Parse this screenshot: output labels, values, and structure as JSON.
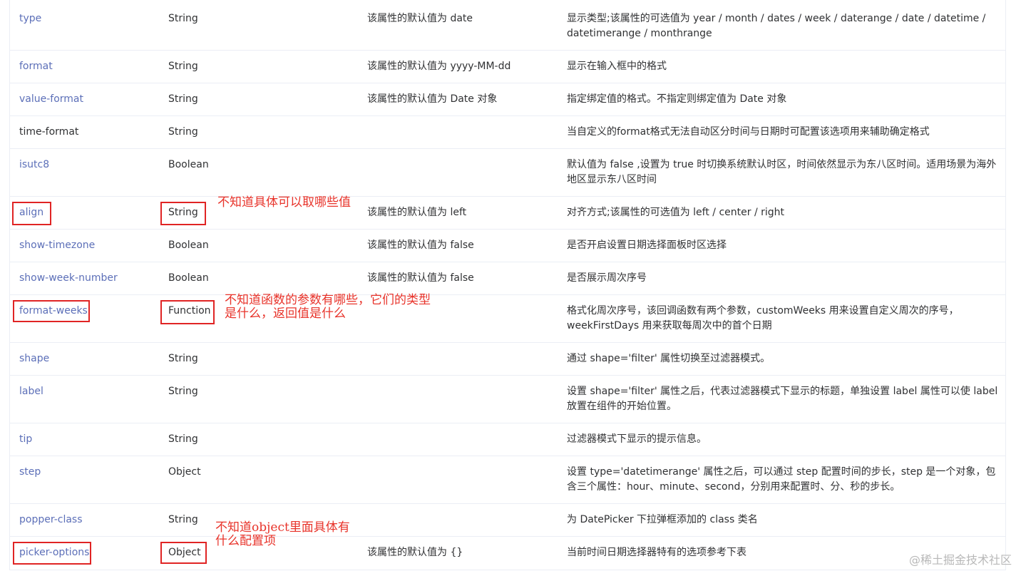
{
  "rows": [
    {
      "name": "type",
      "type": "String",
      "default": "该属性的默认值为 date",
      "desc": "显示类型;该属性的可选值为 year / month / dates / week / daterange / date / datetime / datetimerange / monthrange",
      "link": true
    },
    {
      "name": "format",
      "type": "String",
      "default": "该属性的默认值为 yyyy-MM-dd",
      "desc": "显示在输入框中的格式",
      "link": true
    },
    {
      "name": "value-format",
      "type": "String",
      "default": "该属性的默认值为 Date 对象",
      "desc": "指定绑定值的格式。不指定则绑定值为 Date 对象",
      "link": true
    },
    {
      "name": "time-format",
      "type": "String",
      "default": "",
      "desc": "当自定义的format格式无法自动区分时间与日期时可配置该选项用来辅助确定格式",
      "link": false
    },
    {
      "name": "isutc8",
      "type": "Boolean",
      "default": "",
      "desc": "默认值为 false ,设置为 true 时切换系统默认时区，时间依然显示为东八区时间。适用场景为海外地区显示东八区时间",
      "link": true
    },
    {
      "name": "align",
      "type": "String",
      "default": "该属性的默认值为 left",
      "desc": "对齐方式;该属性的可选值为 left / center / right",
      "link": true
    },
    {
      "name": "show-timezone",
      "type": "Boolean",
      "default": "该属性的默认值为 false",
      "desc": "是否开启设置日期选择面板时区选择",
      "link": true
    },
    {
      "name": "show-week-number",
      "type": "Boolean",
      "default": "该属性的默认值为 false",
      "desc": "是否展示周次序号",
      "link": true
    },
    {
      "name": "format-weeks",
      "type": "Function",
      "default": "",
      "desc": "格式化周次序号，该回调函数有两个参数，customWeeks 用来设置自定义周次的序号，weekFirstDays 用来获取每周次中的首个日期",
      "link": true
    },
    {
      "name": "shape",
      "type": "String",
      "default": "",
      "desc": "通过 shape='filter' 属性切换至过滤器模式。",
      "link": true
    },
    {
      "name": "label",
      "type": "String",
      "default": "",
      "desc": "设置 shape='filter' 属性之后，代表过滤器模式下显示的标题，单独设置 label 属性可以使 label 放置在组件的开始位置。",
      "link": true
    },
    {
      "name": "tip",
      "type": "String",
      "default": "",
      "desc": "过滤器模式下显示的提示信息。",
      "link": true
    },
    {
      "name": "step",
      "type": "Object",
      "default": "",
      "desc": "设置 type='datetimerange' 属性之后，可以通过 step 配置时间的步长，step 是一个对象，包含三个属性：hour、minute、second，分别用来配置时、分、秒的步长。",
      "link": true
    },
    {
      "name": "popper-class",
      "type": "String",
      "default": "",
      "desc": "为 DatePicker 下拉弹框添加的 class 类名",
      "link": true
    },
    {
      "name": "picker-options",
      "type": "Object",
      "default": "该属性的默认值为 {}",
      "desc": "当前时间日期选择器特有的选项参考下表",
      "link": true
    }
  ],
  "annotations": [
    {
      "text": "不知道具体可以取哪些值"
    },
    {
      "text": "不知道函数的参数有哪些，它们的类型是什么，返回值是什么"
    },
    {
      "text": "不知道object里面具体有什么配置项"
    }
  ],
  "watermark": "@稀土掘金技术社区",
  "colors": {
    "link": "#5c6fb8",
    "annotation": "#e02424",
    "border": "#ebeef5"
  }
}
